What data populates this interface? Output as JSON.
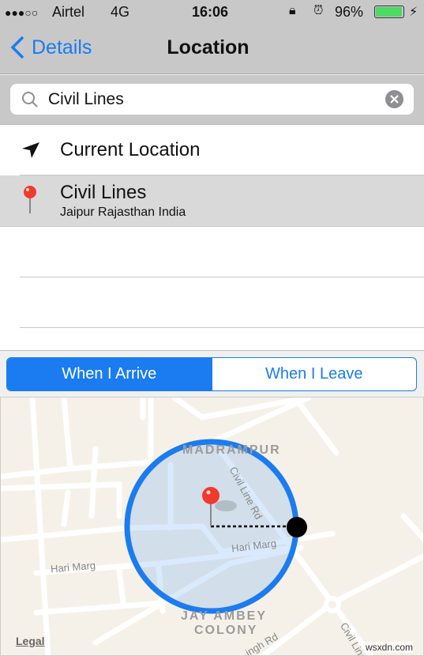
{
  "status_bar": {
    "signal": "●●●○○",
    "carrier": "Airtel",
    "network": "4G",
    "time": "16:06",
    "battery_percent": "96%",
    "battery_level": 0.96,
    "battery_color": "#4cd964"
  },
  "nav": {
    "back_label": "Details",
    "title": "Location"
  },
  "search": {
    "value": "Civil Lines",
    "placeholder": "Search"
  },
  "list": {
    "current_location": "Current Location",
    "result": {
      "title": "Civil Lines",
      "subtitle": "Jaipur Rajasthan India"
    }
  },
  "segmented": {
    "options": [
      "When I Arrive",
      "When I Leave"
    ],
    "selected": 0
  },
  "map": {
    "labels": {
      "area_top": "MADRAMPUR",
      "area_bottom_1": "JAY AMBEY",
      "area_bottom_2": "COLONY"
    },
    "roads": [
      "Civil Line Rd",
      "Hari Marg",
      "Hari Marg",
      "ingh Rd",
      "Civil Line"
    ],
    "legal": "Legal",
    "watermark": "wsxdn.com"
  },
  "colors": {
    "accent": "#1a7cf0",
    "pin": "#f03a2e"
  }
}
